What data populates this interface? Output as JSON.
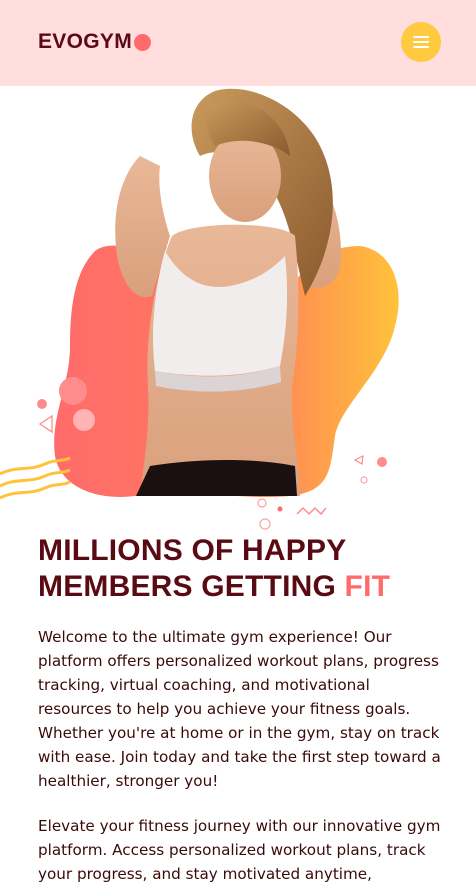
{
  "header": {
    "logo_text": "EVOGYM",
    "menu_icon": "hamburger-icon"
  },
  "hero": {
    "image_desc": "woman in sports bra"
  },
  "headline": {
    "line1": "MILLIONS OF HAPPY",
    "line2_prefix": "MEMBERS GETTING ",
    "line2_accent": "FIT"
  },
  "paragraphs": {
    "p1": "Welcome to the ultimate gym experience! Our platform offers personalized workout plans, progress tracking, virtual coaching, and motivational resources to help you achieve your fitness goals. Whether you're at home or in the gym, stay on track with ease. Join today and take the first step toward a healthier, stronger you!",
    "p2": "Elevate your fitness journey with our innovative gym platform. Access personalized workout plans, track your progress, and stay motivated anytime, anywhere."
  },
  "colors": {
    "header_bg": "#ffdedd",
    "brand_dark": "#5a0a12",
    "accent_coral": "#ff6b6b",
    "accent_yellow": "#ffc940"
  }
}
